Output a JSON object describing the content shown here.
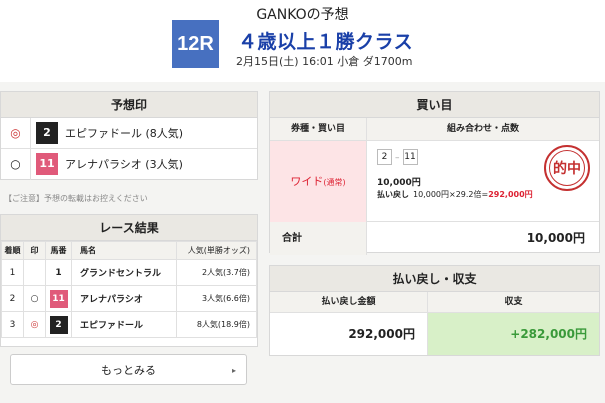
{
  "header": {
    "title": "GANKOの予想",
    "race_no": "12R",
    "race_name": "４歳以上１勝クラス",
    "race_info": "2月15日(土) 16:01 小倉 ダ1700m"
  },
  "yoso": {
    "heading": "予想印",
    "rows": [
      {
        "mark": "◎",
        "num": "2",
        "name": "エピファドール (8人気)"
      },
      {
        "mark": "○",
        "num": "11",
        "name": "アレナパラシオ (3人気)"
      }
    ]
  },
  "caution": "【ご注意】予想の転載はお控えください",
  "result": {
    "heading": "レース結果",
    "cols": {
      "rank": "着順",
      "mark": "印",
      "num": "馬番",
      "name": "馬名",
      "pop": "人気(単勝オッズ)"
    },
    "rows": [
      {
        "rank": "1",
        "mark": "",
        "num": "1",
        "name": "グランドセントラル",
        "pop": "2人気(3.7倍)"
      },
      {
        "rank": "2",
        "mark": "○",
        "num": "11",
        "name": "アレナパラシオ",
        "pop": "3人気(6.6倍)"
      },
      {
        "rank": "3",
        "mark": "◎",
        "num": "2",
        "name": "エピファドール",
        "pop": "8人気(18.9倍)"
      }
    ],
    "more_label": "もっとみる",
    "more_arrow": "▸"
  },
  "kaime": {
    "heading": "買い目",
    "col_left": "券種・買い目",
    "col_right": "組み合わせ・点数",
    "ticket_type": "ワイド",
    "ticket_sub": "(通常)",
    "combo": [
      "2",
      "11"
    ],
    "bet_amount": "10,000円",
    "payout_label": "払い戻し",
    "payout_calc": "10,000円×29.2倍=",
    "payout_value": "292,000円",
    "stamp": "的中",
    "total_label": "合計",
    "total_value": "10,000円"
  },
  "harai": {
    "heading": "払い戻し・収支",
    "col_left": "払い戻し金額",
    "col_right": "収支",
    "payout": "292,000円",
    "balance": "+282,000円"
  },
  "colors": {
    "race_badge": "#4770c0",
    "race_name": "#1a40a8",
    "hit_red": "#d23",
    "profit_green": "#3a9a3a"
  }
}
